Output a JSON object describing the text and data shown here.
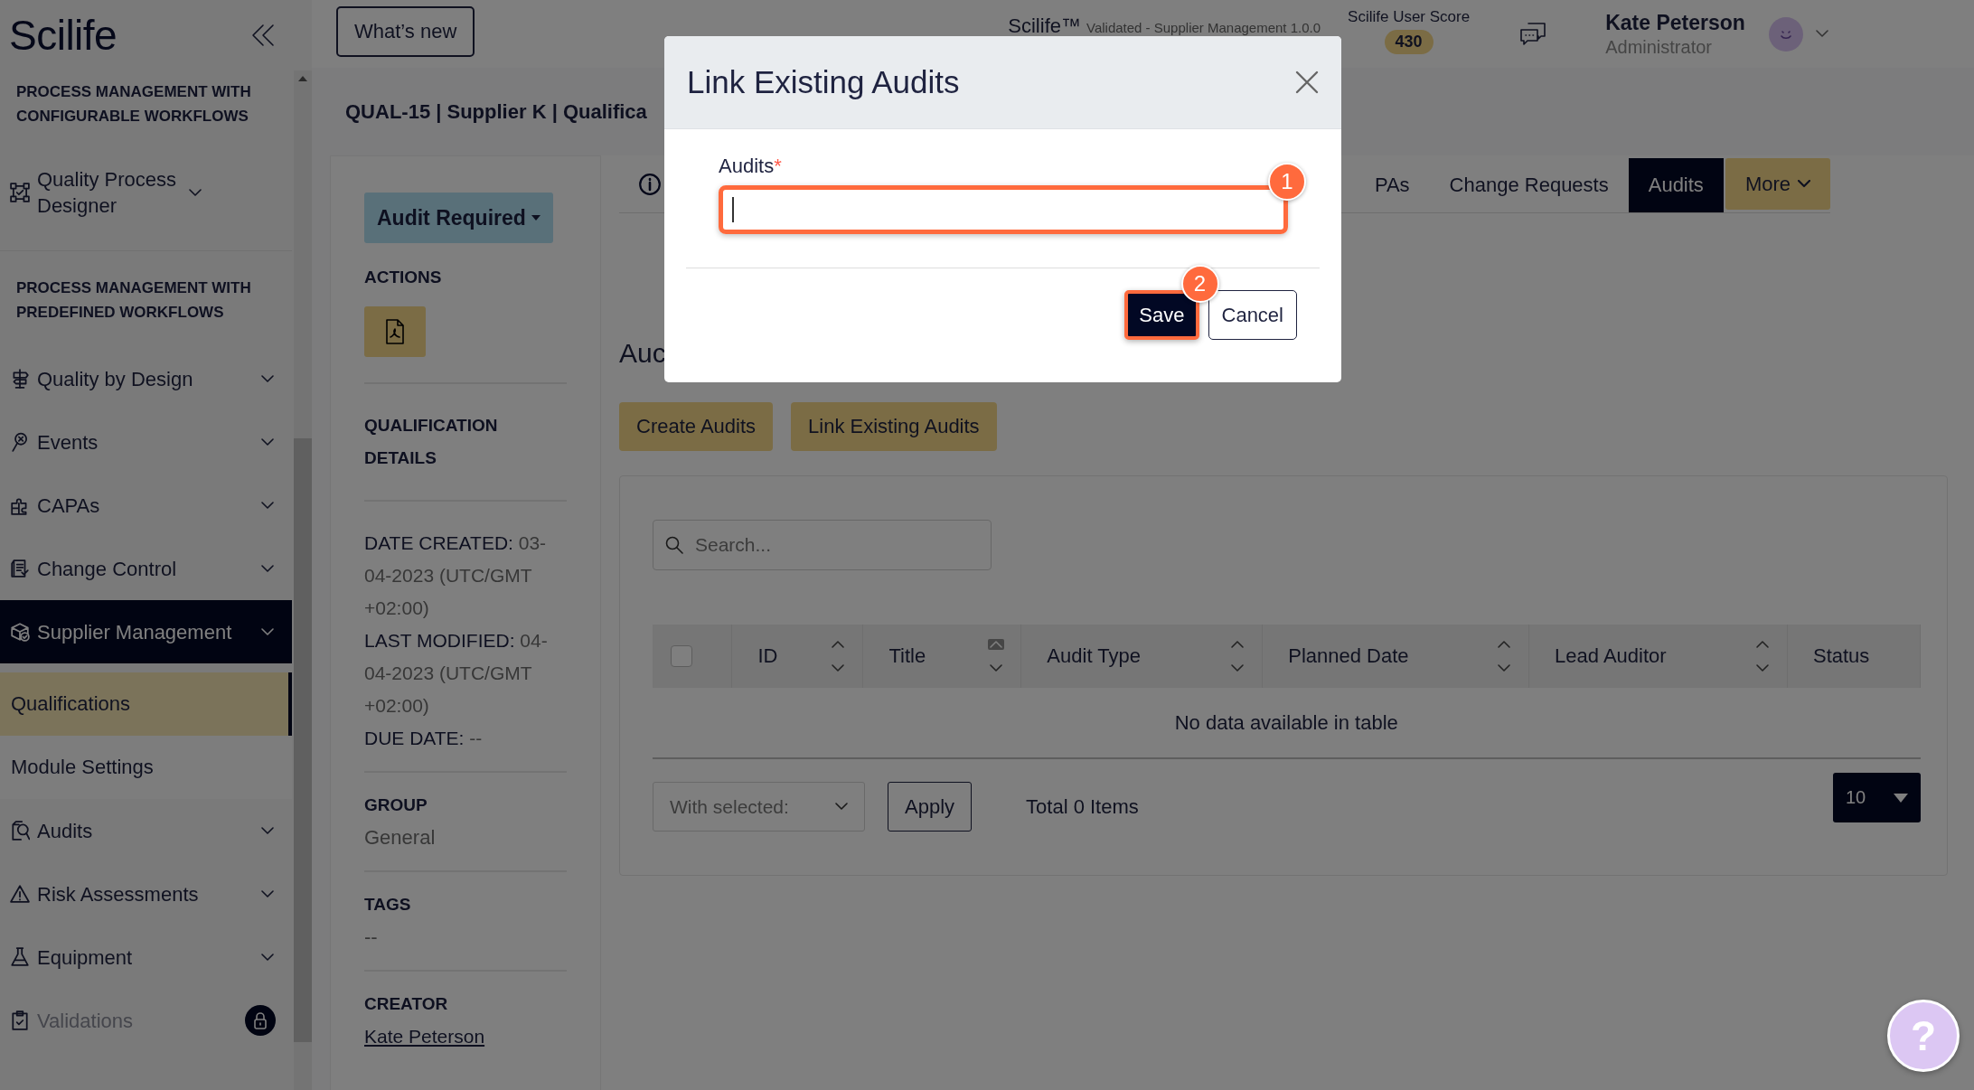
{
  "app": {
    "logo": "Scilife",
    "whats_new": "What’s new",
    "product": "Scilife™",
    "product_subtitle": "Validated - Supplier Management 1.0.0",
    "score_label": "Scilife User Score",
    "score": "430",
    "user_name": "Kate Peterson",
    "user_role": "Administrator"
  },
  "sidebar": {
    "sections": [
      {
        "heading": "PROCESS MANAGEMENT WITH CONFIGURABLE WORKFLOWS",
        "items": [
          {
            "label": "Quality Process Designer",
            "expanded": false,
            "locked": false
          }
        ]
      },
      {
        "heading": "PROCESS MANAGEMENT WITH PREDEFINED WORKFLOWS",
        "items": [
          {
            "label": "Quality by Design",
            "expanded": false,
            "locked": false
          },
          {
            "label": "Events",
            "expanded": false,
            "locked": false
          },
          {
            "label": "CAPAs",
            "expanded": false,
            "locked": false
          },
          {
            "label": "Change Control",
            "expanded": false,
            "locked": false
          },
          {
            "label": "Supplier Management",
            "expanded": true,
            "locked": false,
            "children": [
              {
                "label": "Qualifications",
                "selected": true
              },
              {
                "label": "Module Settings",
                "selected": false
              }
            ]
          },
          {
            "label": "Audits",
            "expanded": false,
            "locked": false
          },
          {
            "label": "Risk Assessments",
            "expanded": false,
            "locked": false
          },
          {
            "label": "Equipment",
            "expanded": false,
            "locked": false
          },
          {
            "label": "Validations",
            "expanded": false,
            "locked": true
          }
        ]
      }
    ]
  },
  "record": {
    "title": "QUAL-15 | Supplier K | Qualifica"
  },
  "details": {
    "status": "Audit Required",
    "actions_heading": "ACTIONS",
    "section_heading": "QUALIFICATION DETAILS",
    "dates": [
      {
        "label": "DATE CREATED:",
        "value": "03-04-2023 (UTC/GMT +02:00)"
      },
      {
        "label": "LAST MODIFIED:",
        "value": "04-04-2023 (UTC/GMT +02:00)"
      },
      {
        "label": "DUE DATE:",
        "value": "--"
      }
    ],
    "group": {
      "label": "GROUP",
      "value": "General"
    },
    "tags": {
      "label": "TAGS",
      "value": "--"
    },
    "creator": {
      "label": "CREATOR",
      "value": "Kate Peterson"
    }
  },
  "tabs": [
    {
      "label": "PAs",
      "kind": "tab",
      "selected": false
    },
    {
      "label": "Change Requests",
      "kind": "tab",
      "selected": false
    },
    {
      "label": "Audits",
      "kind": "tab",
      "selected": true
    },
    {
      "label": "More",
      "kind": "dropdown",
      "selected": false
    }
  ],
  "audits": {
    "heading": "Auc",
    "buttons": [
      "Create Audits",
      "Link Existing Audits"
    ],
    "search": {
      "placeholder": "Search..."
    },
    "table": {
      "select_all_checked": false,
      "columns": [
        {
          "label": "ID",
          "sorted": false
        },
        {
          "label": "Title",
          "sorted": true
        },
        {
          "label": "Audit Type",
          "sorted": false
        },
        {
          "label": "Planned Date",
          "sorted": false
        },
        {
          "label": "Lead Auditor",
          "sorted": false
        },
        {
          "label": "Status"
        }
      ],
      "empty_message": "No data available in table"
    },
    "bulk_action": {
      "placeholder": "With selected:"
    },
    "apply": "Apply",
    "total": "Total 0 Items",
    "page_size": "10"
  },
  "modal": {
    "title": "Link Existing Audits",
    "field": {
      "label": "Audits",
      "required_mark": "*",
      "marker": "1"
    },
    "save": {
      "label": "Save",
      "marker": "2"
    },
    "cancel": "Cancel"
  },
  "help": {
    "label": "?"
  }
}
